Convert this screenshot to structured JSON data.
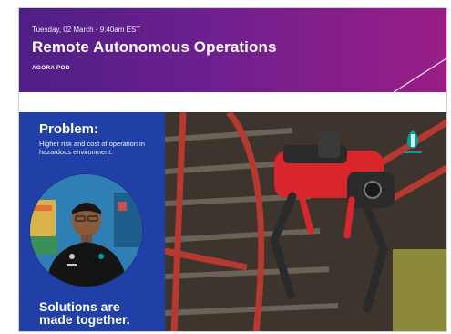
{
  "header": {
    "date": "Tuesday, 02 March - 9:40am EST",
    "title": "Remote Autonomous Operations",
    "subtitle": "AGORA POD"
  },
  "panel": {
    "problem_title": "Problem:",
    "problem_text": "Higher risk and cost of operation in hazardous environment.",
    "solutions_line1": "Solutions are",
    "solutions_line2": "made together."
  },
  "brand": {
    "logo_icon": "petronas-logo-icon",
    "accent_color": "#6e1f8f",
    "panel_color": "#2040a8",
    "logo_color": "#00a19c"
  }
}
